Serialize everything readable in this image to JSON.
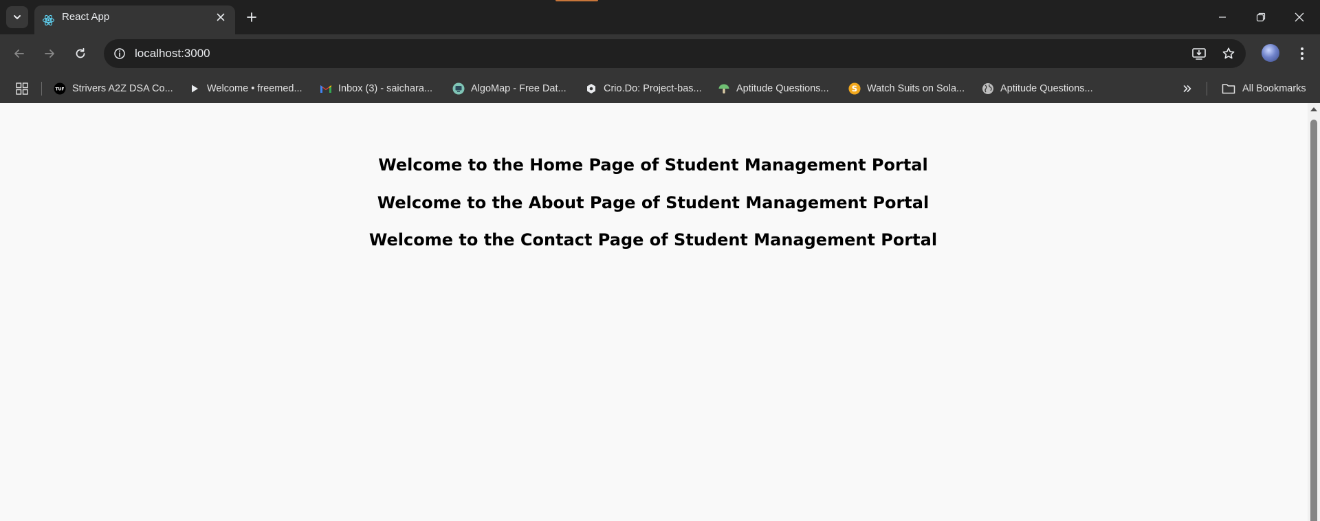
{
  "tab": {
    "title": "React App",
    "favicon": "react-icon"
  },
  "toolbar": {
    "url": "localhost:3000"
  },
  "bookmarks": [
    {
      "label": "Strivers A2Z DSA Co...",
      "icon": "tuf-logo-icon"
    },
    {
      "label": "Welcome • freemed...",
      "icon": "play-icon"
    },
    {
      "label": "Inbox (3) - saichara...",
      "icon": "gmail-icon"
    },
    {
      "label": "AlgoMap - Free Dat...",
      "icon": "algomap-icon"
    },
    {
      "label": "Crio.Do: Project-bas...",
      "icon": "crio-icon"
    },
    {
      "label": "Aptitude Questions...",
      "icon": "mushroom-icon"
    },
    {
      "label": "Watch Suits on Sola...",
      "icon": "sola-icon"
    },
    {
      "label": "Aptitude Questions...",
      "icon": "globe-icon"
    }
  ],
  "all_bookmarks_label": "All Bookmarks",
  "page": {
    "headings": [
      "Welcome to the Home Page of Student Management Portal",
      "Welcome to the About Page of Student Management Portal",
      "Welcome to the Contact Page of Student Management Portal"
    ]
  },
  "colors": {
    "chrome_dark": "#202020",
    "toolbar": "#353535",
    "page_background": "#f9f9f9",
    "react_blue": "#61dafb"
  }
}
